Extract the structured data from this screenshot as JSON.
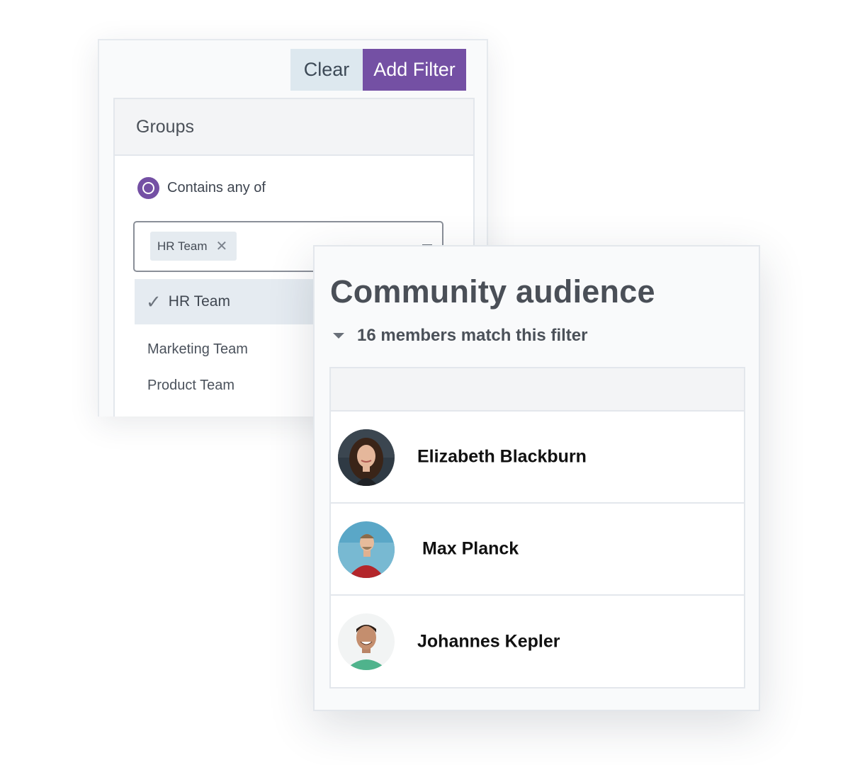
{
  "filter": {
    "clear_label": "Clear",
    "add_filter_label": "Add Filter",
    "panel_title": "Groups",
    "condition_label": "Contains any of",
    "selected_chip": "HR Team",
    "options": [
      "HR Team",
      "Marketing Team",
      "Product Team"
    ],
    "selected_option": "HR Team"
  },
  "audience": {
    "title": "Community audience",
    "match_text": "16 members match this filter",
    "members": [
      {
        "name": "Elizabeth Blackburn",
        "avatar": "avatar-woman-dark-hair"
      },
      {
        "name": "Max Planck",
        "avatar": "avatar-man-red-shirt"
      },
      {
        "name": "Johannes Kepler",
        "avatar": "avatar-man-green-shirt"
      }
    ]
  },
  "colors": {
    "accent": "#7450a4",
    "clear_bg": "#dde8ef",
    "selected_option_bg": "#e5ebf1"
  },
  "icons": {
    "chip_remove": "close-icon",
    "selected_check": "check-icon",
    "expand": "caret-down-icon"
  }
}
